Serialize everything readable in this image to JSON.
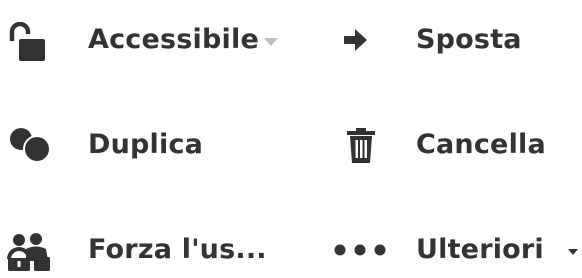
{
  "actions": {
    "accessibility": {
      "label": "Accessibile",
      "icon": "unlock-icon"
    },
    "move": {
      "label": "Sposta",
      "icon": "arrow-right-icon"
    },
    "duplicate": {
      "label": "Duplica",
      "icon": "duplicate-circles-icon"
    },
    "delete": {
      "label": "Cancella",
      "icon": "trash-icon"
    },
    "force_user": {
      "label": "Forza l'us...",
      "icon": "users-lock-icon"
    },
    "more": {
      "label": "Ulteriori",
      "icon": "ellipsis-icon"
    }
  },
  "colors": {
    "text": "#333333",
    "caret_muted": "#bdbdbd"
  }
}
